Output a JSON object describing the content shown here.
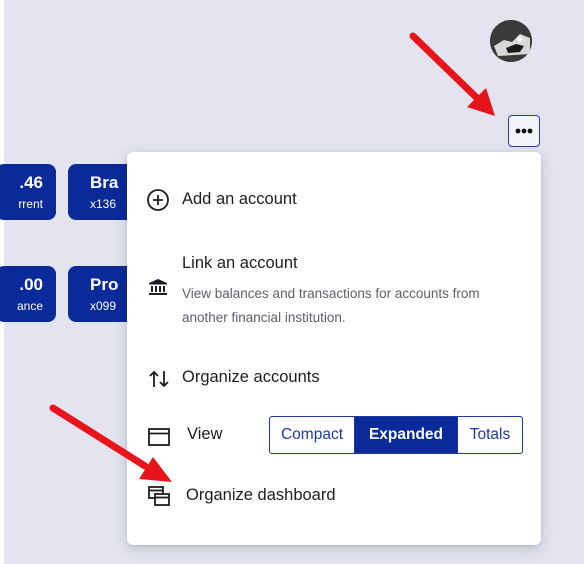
{
  "user_avatar": "user-avatar",
  "more_button_icon": "more-horizontal-icon",
  "accounts": [
    {
      "amount": ".46",
      "sub": "rrent"
    },
    {
      "amount": "Bra",
      "sub": "x136"
    },
    {
      "amount": ".00",
      "sub": "ance"
    },
    {
      "amount": "Pro",
      "sub": "x099"
    }
  ],
  "menu": {
    "add_account": {
      "label": "Add an account",
      "icon": "plus-circle-icon"
    },
    "link_account": {
      "label": "Link an account",
      "description": "View balances and transactions for accounts from another financial institution.",
      "icon": "bank-icon"
    },
    "organize_accounts": {
      "label": "Organize accounts",
      "icon": "sort-arrows-icon"
    },
    "view": {
      "label": "View",
      "icon": "window-icon",
      "options": [
        "Compact",
        "Expanded",
        "Totals"
      ],
      "selected": "Expanded"
    },
    "organize_dashboard": {
      "label": "Organize dashboard",
      "icon": "stacked-windows-icon"
    }
  },
  "colors": {
    "background": "#e3e4ef",
    "card": "#0a2a99",
    "accent": "#1c3a9c",
    "annotation_arrow": "#e8141b"
  }
}
